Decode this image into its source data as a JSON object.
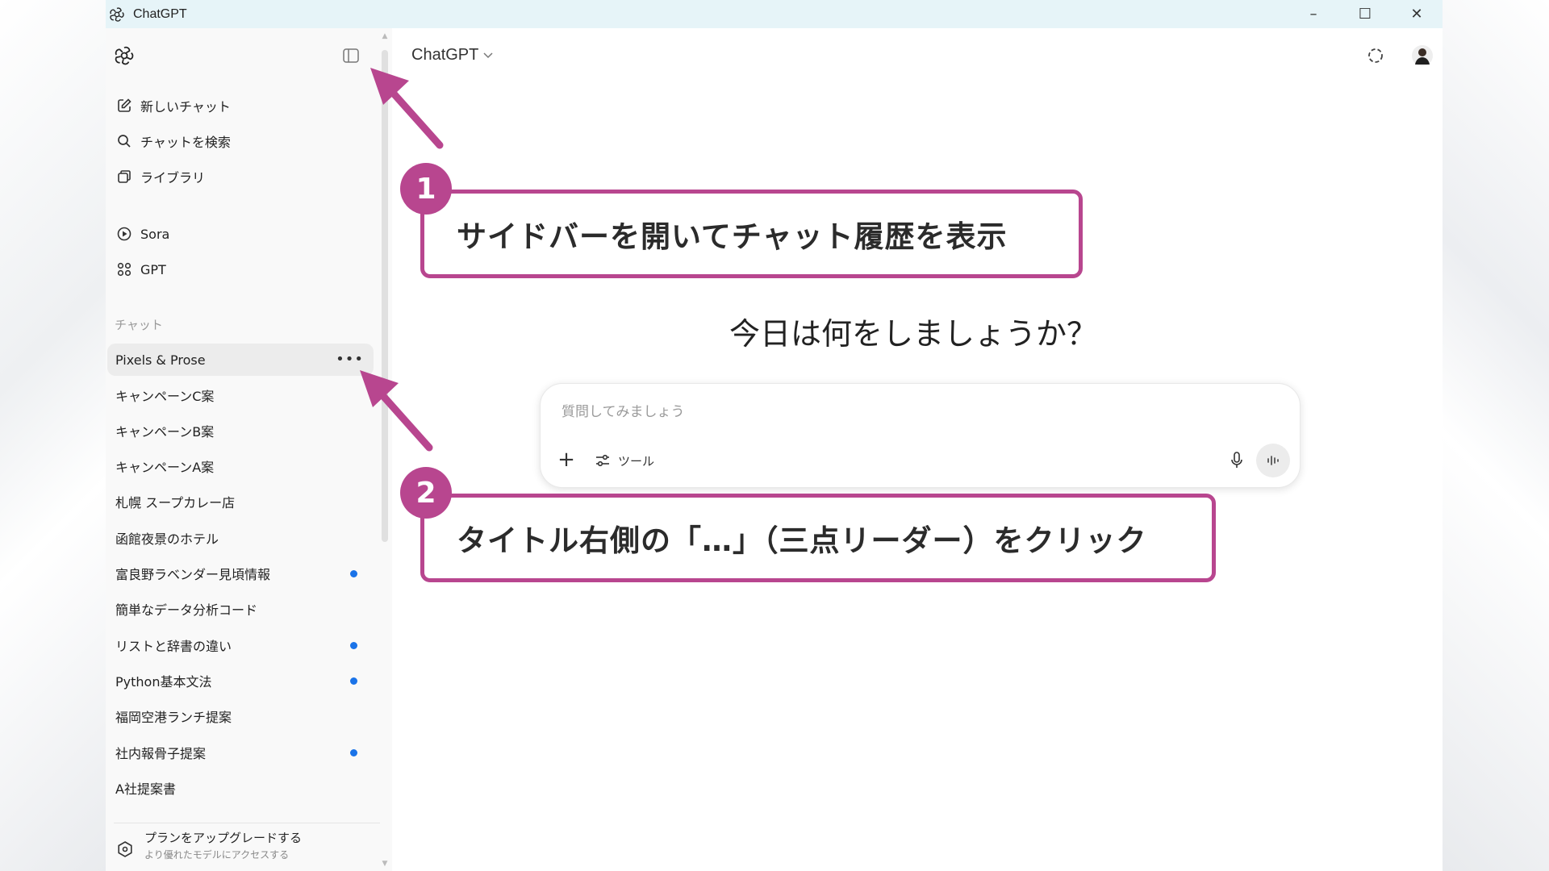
{
  "window": {
    "title": "ChatGPT",
    "controls": {
      "minimize": "–",
      "maximize": "☐",
      "close": "✕"
    }
  },
  "sidebar": {
    "nav": [
      {
        "label": "新しいチャット",
        "icon": "edit-icon"
      },
      {
        "label": "チャットを検索",
        "icon": "search-icon"
      },
      {
        "label": "ライブラリ",
        "icon": "library-icon"
      },
      {
        "label": "Sora",
        "icon": "play-circle-icon"
      },
      {
        "label": "GPT",
        "icon": "grid-icon"
      }
    ],
    "section_label": "チャット",
    "chats": [
      {
        "title": "Pixels & Prose",
        "active": true,
        "more": "•••"
      },
      {
        "title": "キャンペーンC案"
      },
      {
        "title": "キャンペーンB案"
      },
      {
        "title": "キャンペーンA案"
      },
      {
        "title": "札幌 スープカレー店"
      },
      {
        "title": "函館夜景のホテル"
      },
      {
        "title": "富良野ラベンダー見頃情報",
        "unread": true
      },
      {
        "title": "簡単なデータ分析コード"
      },
      {
        "title": "リストと辞書の違い",
        "unread": true
      },
      {
        "title": "Python基本文法",
        "unread": true
      },
      {
        "title": "福岡空港ランチ提案"
      },
      {
        "title": "社内報骨子提案",
        "unread": true
      },
      {
        "title": "A社提案書"
      }
    ],
    "upgrade": {
      "title": "プランをアップグレードする",
      "subtitle": "より優れたモデルにアクセスする"
    }
  },
  "main": {
    "model_selector": "ChatGPT",
    "greeting": "今日は何をしましょうか？",
    "composer": {
      "placeholder": "質問してみましょう",
      "plus": "+",
      "tools_label": "ツール"
    }
  },
  "annotations": [
    {
      "number": "1",
      "text": "サイドバーを開いてチャット履歴を表示"
    },
    {
      "number": "2",
      "text": "タイトル右側の「…」（三点リーダー）をクリック"
    }
  ],
  "colors": {
    "annotation": "#b8468f",
    "titlebar": "#e6f4f8",
    "unread_dot": "#1a73e8"
  }
}
